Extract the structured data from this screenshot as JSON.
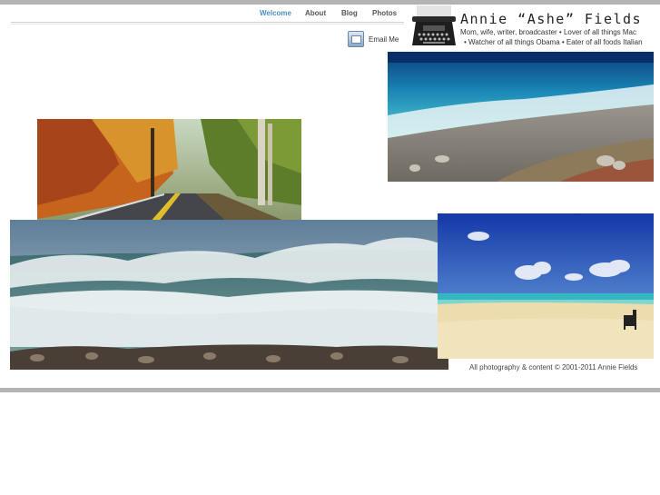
{
  "nav": {
    "items": [
      {
        "label": "Welcome",
        "active": true
      },
      {
        "label": "About",
        "active": false
      },
      {
        "label": "Blog",
        "active": false
      },
      {
        "label": "Photos",
        "active": false
      }
    ]
  },
  "email": {
    "label": "Email Me",
    "icon": "mail-icon"
  },
  "brand": {
    "title": "Annie “Ashe” Fields",
    "line1": "Mom, wife, writer, broadcaster • Lover of all things Mac",
    "line2": "• Watcher of all things Obama • Eater of all foods Italian",
    "logo": "typewriter-icon"
  },
  "footer": {
    "text": "All photography & content © 2001-2011 Annie Fields"
  },
  "colors": {
    "accent": "#4a8ec4",
    "bar": "#b3b3b3"
  }
}
